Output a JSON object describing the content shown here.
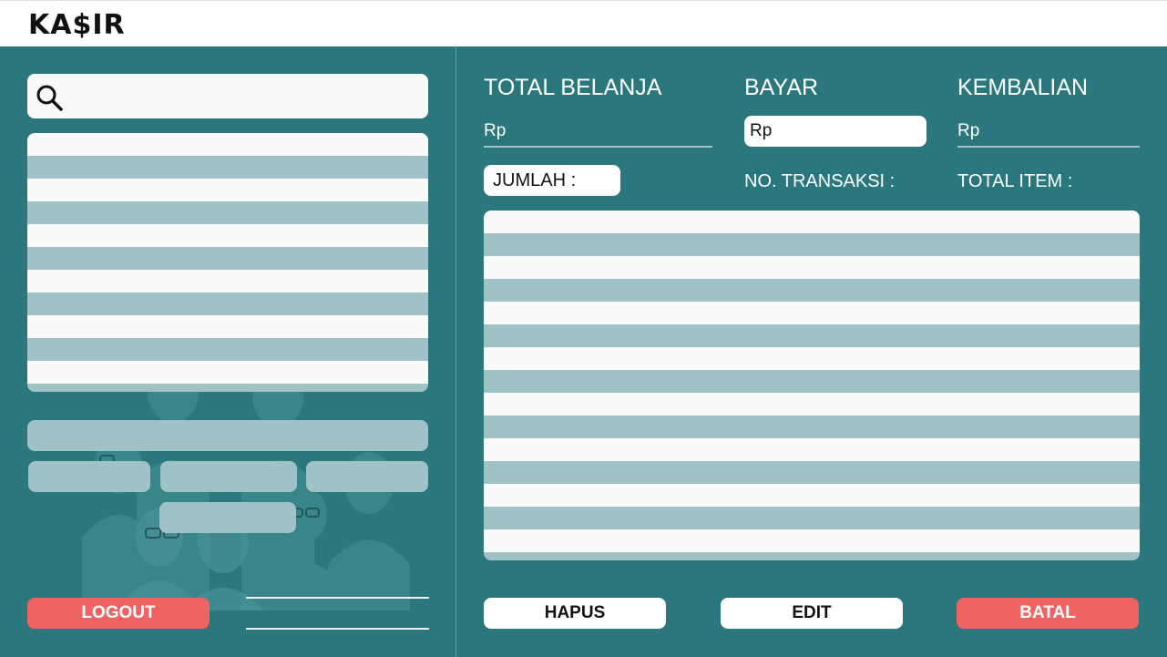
{
  "app": {
    "title": "KA$IR"
  },
  "search": {
    "placeholder": ""
  },
  "summary": {
    "total_label": "TOTAL BELANJA",
    "total_value": "Rp",
    "bayar_label": "BAYAR",
    "bayar_value": "Rp",
    "kembalian_label": "KEMBALIAN",
    "kembalian_value": "Rp",
    "jumlah_label": "JUMLAH :",
    "transaksi_label": "NO. TRANSAKSI :",
    "total_item_label": "TOTAL ITEM :"
  },
  "buttons": {
    "logout": "LOGOUT",
    "hapus": "HAPUS",
    "edit": "EDIT",
    "batal": "BATAL"
  },
  "colors": {
    "panel_background": "#2a777d",
    "stripe": "#9ec2c5",
    "danger": "#ef6363",
    "surface": "#fafafa"
  },
  "icons": {
    "search": "search-icon",
    "illustration": "people-illustration"
  }
}
